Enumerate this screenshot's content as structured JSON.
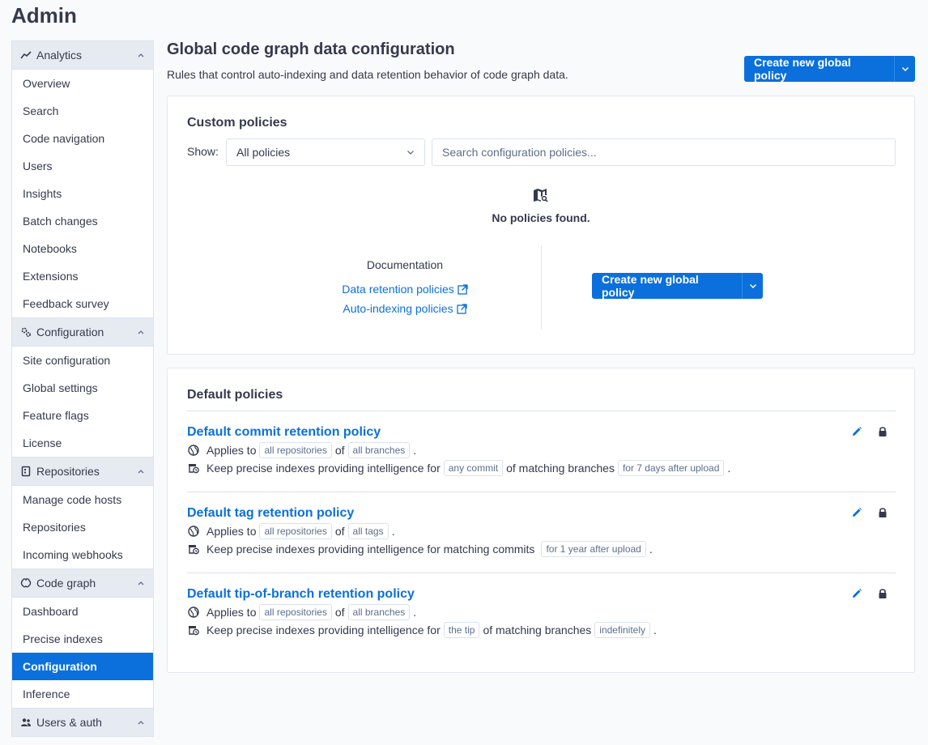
{
  "admin_title": "Admin",
  "sidebar": {
    "groups": [
      {
        "label": "Analytics",
        "icon": "chart-line-icon",
        "items": [
          "Overview",
          "Search",
          "Code navigation",
          "Users",
          "Insights",
          "Batch changes",
          "Notebooks",
          "Extensions",
          "Feedback survey"
        ]
      },
      {
        "label": "Configuration",
        "icon": "cogs-icon",
        "items": [
          "Site configuration",
          "Global settings",
          "Feature flags",
          "License"
        ]
      },
      {
        "label": "Repositories",
        "icon": "repository-icon",
        "items": [
          "Manage code hosts",
          "Repositories",
          "Incoming webhooks"
        ]
      },
      {
        "label": "Code graph",
        "icon": "brain-icon",
        "items": [
          "Dashboard",
          "Precise indexes",
          "Configuration",
          "Inference"
        ]
      },
      {
        "label": "Users & auth",
        "icon": "users-icon",
        "items": []
      }
    ],
    "active_item": "Configuration"
  },
  "page": {
    "title": "Global code graph data configuration",
    "subtitle": "Rules that control auto-indexing and data retention behavior of code graph data.",
    "create_button": "Create new global policy"
  },
  "custom_policies": {
    "title": "Custom policies",
    "show_label": "Show:",
    "filter_value": "All policies",
    "search_placeholder": "Search configuration policies...",
    "empty_text": "No policies found.",
    "documentation_title": "Documentation",
    "doc_links": [
      "Data retention policies",
      "Auto-indexing policies"
    ],
    "create_button": "Create new global policy"
  },
  "default_policies": {
    "title": "Default policies",
    "policies": [
      {
        "name": "Default commit retention policy",
        "applies_prefix": "Applies to",
        "applies_repos": "all repositories",
        "applies_of": "of",
        "applies_target": "all branches",
        "keep_prefix": "Keep precise indexes providing intelligence for",
        "keep_target": "any commit",
        "keep_middle": "of matching branches",
        "keep_duration": "for 7 days after upload"
      },
      {
        "name": "Default tag retention policy",
        "applies_prefix": "Applies to",
        "applies_repos": "all repositories",
        "applies_of": "of",
        "applies_target": "all tags",
        "keep_prefix": "Keep precise indexes providing intelligence for matching commits",
        "keep_target": "",
        "keep_middle": "",
        "keep_duration": "for 1 year after upload"
      },
      {
        "name": "Default tip-of-branch retention policy",
        "applies_prefix": "Applies to",
        "applies_repos": "all repositories",
        "applies_of": "of",
        "applies_target": "all branches",
        "keep_prefix": "Keep precise indexes providing intelligence for",
        "keep_target": "the tip",
        "keep_middle": "of matching branches",
        "keep_duration": "indefinitely"
      }
    ]
  },
  "colors": {
    "accent": "#0b70db",
    "text": "#343a4d",
    "muted": "#5e6e8c"
  }
}
